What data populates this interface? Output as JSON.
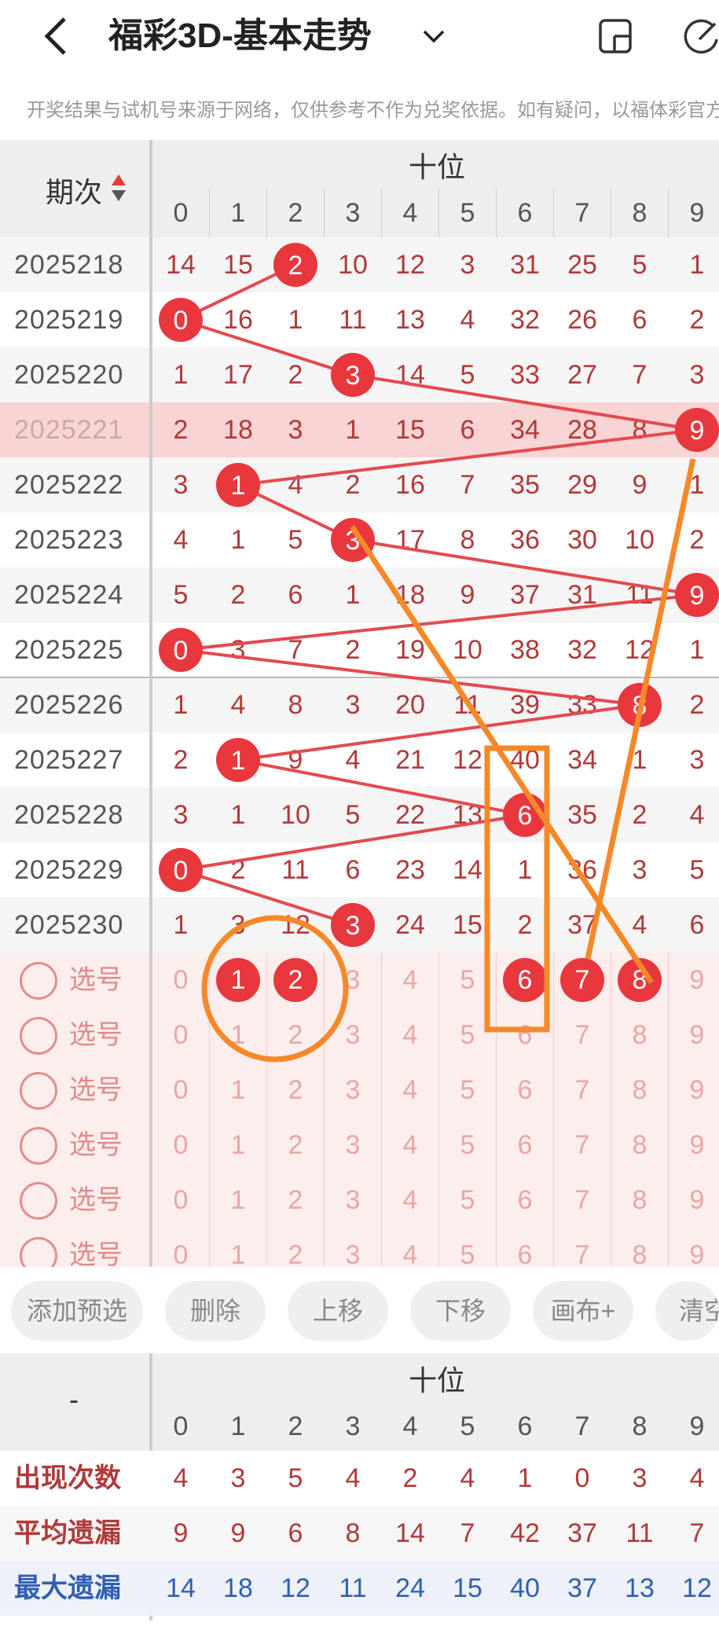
{
  "header": {
    "title": "福彩3D-基本走势"
  },
  "notice": "开奖结果与试机号来源于网络，仅供参考不作为兑奖依据。如有疑问，以福体彩官方",
  "table": {
    "issue_header": "期次",
    "group_label": "十位",
    "digits": [
      "0",
      "1",
      "2",
      "3",
      "4",
      "5",
      "6",
      "7",
      "8",
      "9"
    ],
    "rows": [
      {
        "issue": "2025218",
        "cells": [
          "14",
          "15",
          "2",
          "10",
          "12",
          "3",
          "31",
          "25",
          "5",
          "1"
        ],
        "hit": 2
      },
      {
        "issue": "2025219",
        "cells": [
          "0",
          "16",
          "1",
          "11",
          "13",
          "4",
          "32",
          "26",
          "6",
          "2"
        ],
        "hit": 0
      },
      {
        "issue": "2025220",
        "cells": [
          "1",
          "17",
          "2",
          "3",
          "14",
          "5",
          "33",
          "27",
          "7",
          "3"
        ],
        "hit": 3
      },
      {
        "issue": "2025221",
        "cells": [
          "2",
          "18",
          "3",
          "1",
          "15",
          "6",
          "34",
          "28",
          "8",
          "9"
        ],
        "hit": 9
      },
      {
        "issue": "2025222",
        "cells": [
          "3",
          "1",
          "4",
          "2",
          "16",
          "7",
          "35",
          "29",
          "9",
          "1"
        ],
        "hit": 1
      },
      {
        "issue": "2025223",
        "cells": [
          "4",
          "1",
          "5",
          "3",
          "17",
          "8",
          "36",
          "30",
          "10",
          "2"
        ],
        "hit": 3
      },
      {
        "issue": "2025224",
        "cells": [
          "5",
          "2",
          "6",
          "1",
          "18",
          "9",
          "37",
          "31",
          "11",
          "9"
        ],
        "hit": 9
      },
      {
        "issue": "2025225",
        "cells": [
          "0",
          "3",
          "7",
          "2",
          "19",
          "10",
          "38",
          "32",
          "12",
          "1"
        ],
        "hit": 0
      },
      {
        "issue": "2025226",
        "cells": [
          "1",
          "4",
          "8",
          "3",
          "20",
          "11",
          "39",
          "33",
          "8",
          "2"
        ],
        "hit": 8
      },
      {
        "issue": "2025227",
        "cells": [
          "2",
          "1",
          "9",
          "4",
          "21",
          "12",
          "40",
          "34",
          "1",
          "3"
        ],
        "hit": 1
      },
      {
        "issue": "2025228",
        "cells": [
          "3",
          "1",
          "10",
          "5",
          "22",
          "13",
          "6",
          "35",
          "2",
          "4"
        ],
        "hit": 6
      },
      {
        "issue": "2025229",
        "cells": [
          "0",
          "2",
          "11",
          "6",
          "23",
          "14",
          "1",
          "36",
          "3",
          "5"
        ],
        "hit": 0
      },
      {
        "issue": "2025230",
        "cells": [
          "1",
          "3",
          "12",
          "3",
          "24",
          "15",
          "2",
          "37",
          "4",
          "6"
        ],
        "hit": 3
      }
    ]
  },
  "selection": {
    "label": "选号",
    "rows": [
      {
        "selected": [
          1,
          2,
          6,
          7,
          8
        ]
      },
      {
        "selected": []
      },
      {
        "selected": []
      },
      {
        "selected": []
      },
      {
        "selected": []
      },
      {
        "selected": []
      }
    ]
  },
  "buttons": [
    "添加预选",
    "删除",
    "上移",
    "下移",
    "画布+",
    "清空"
  ],
  "stats": {
    "left_label": "-",
    "group_label": "十位",
    "rows": [
      {
        "label": "出现次数",
        "values": [
          "4",
          "3",
          "5",
          "4",
          "2",
          "4",
          "1",
          "0",
          "3",
          "4"
        ],
        "color": "#b03a3a"
      },
      {
        "label": "平均遗漏",
        "values": [
          "9",
          "9",
          "6",
          "8",
          "14",
          "7",
          "42",
          "37",
          "11",
          "7"
        ],
        "color": "#b03a3a"
      },
      {
        "label": "最大遗漏",
        "values": [
          "14",
          "18",
          "12",
          "11",
          "24",
          "15",
          "40",
          "37",
          "13",
          "12"
        ],
        "color": "#2f5fb3"
      }
    ]
  },
  "colors": {
    "accent": "#e8373d",
    "annotation": "#f5892a",
    "highlight_row": "#f9d4d4",
    "selection_bg": "#fdeeee"
  }
}
